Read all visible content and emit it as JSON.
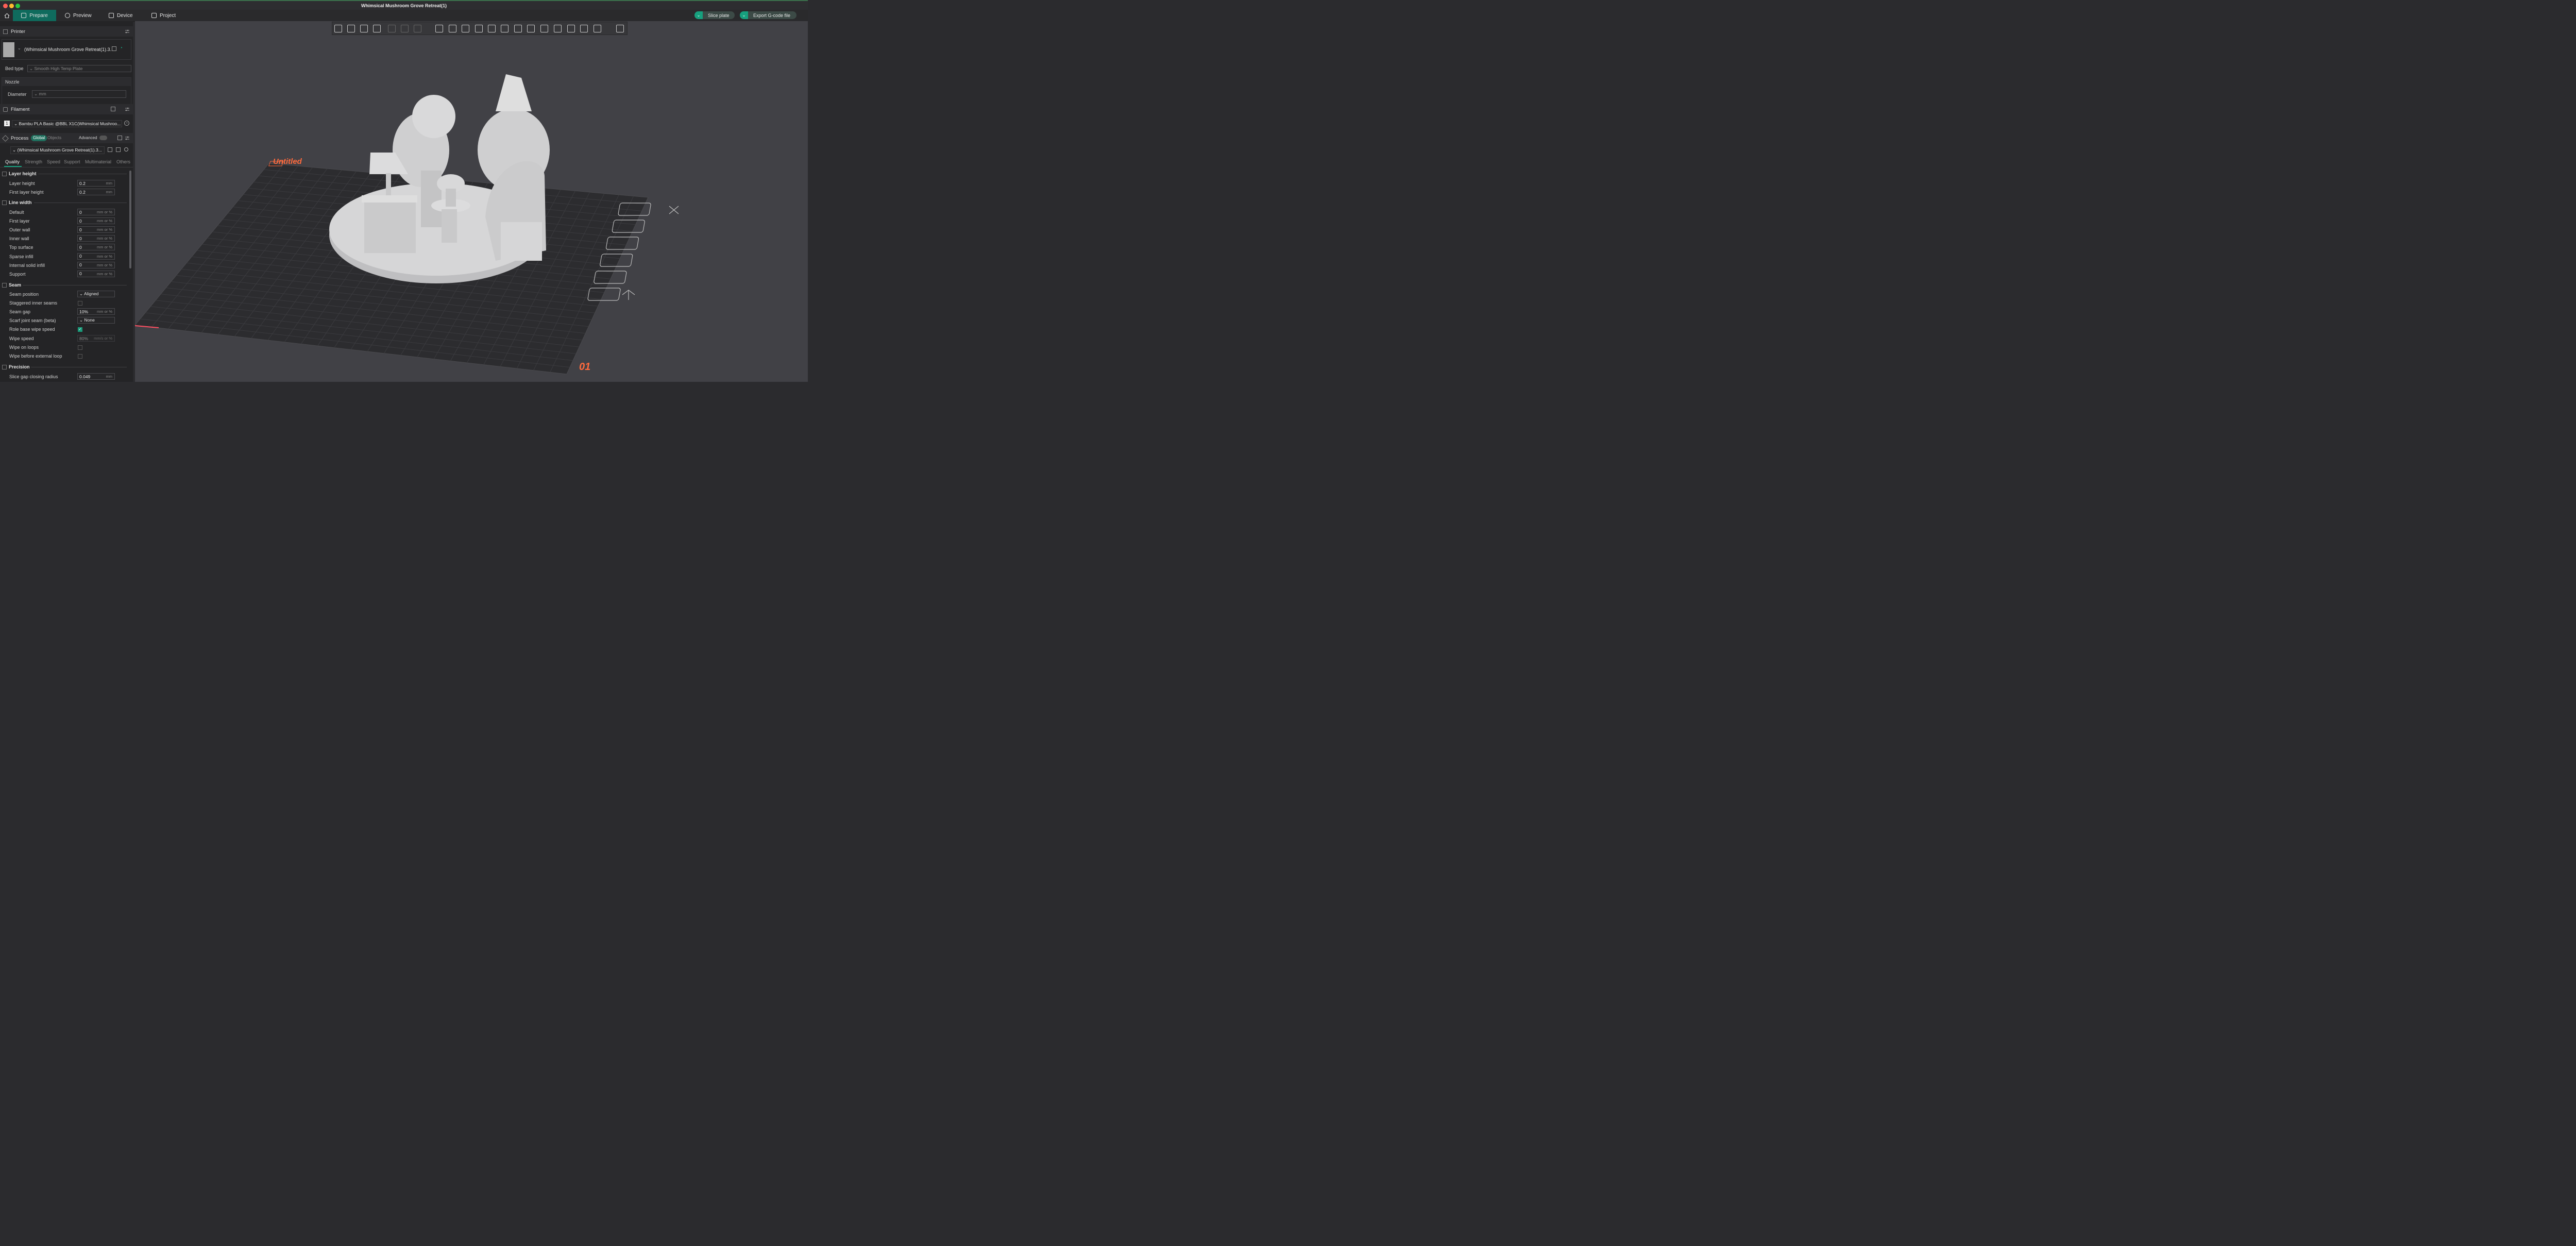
{
  "window": {
    "title": "Whimsical Mushroom Grove Retreat(1)"
  },
  "colors": {
    "accent": "#17a07e",
    "active_tab": "#0f6b5d",
    "plate_label": "#ff6a3d"
  },
  "menubar": {
    "tabs": [
      {
        "label": "Prepare",
        "icon": "cube-icon"
      },
      {
        "label": "Preview",
        "icon": "layers-icon"
      },
      {
        "label": "Device",
        "icon": "device-icon"
      },
      {
        "label": "Project",
        "icon": "project-icon"
      }
    ],
    "slice_label": "Slice plate",
    "export_label": "Export G-code file"
  },
  "printer": {
    "header": "Printer",
    "name": "(Whimsical Mushroom Grove Retreat(1).3...",
    "bed_type_label": "Bed type",
    "bed_type_value": "Smooth High Temp Plate",
    "nozzle_label": "Nozzle",
    "diameter_label": "Diameter",
    "diameter_unit": "mm"
  },
  "filament": {
    "header": "Filament",
    "slot": "1",
    "name": "Bambu PLA Basic @BBL X1C(Whimsical Mushroo..."
  },
  "process": {
    "header": "Process",
    "global_label": "Global",
    "objects_label": "Objects",
    "advanced_label": "Advanced",
    "preset": "(Whimsical Mushroom Grove Retreat(1).3...",
    "tabs": [
      "Quality",
      "Strength",
      "Speed",
      "Support",
      "Multimaterial",
      "Others"
    ]
  },
  "quality": {
    "layer_height_group": "Layer height",
    "layer_height_label": "Layer height",
    "layer_height": "0.2",
    "first_layer_height_label": "First layer height",
    "first_layer_height": "0.2",
    "unit_mm": "mm",
    "unit_mm_pct": "mm or %",
    "line_width_group": "Line width",
    "line_widths": [
      {
        "label": "Default",
        "value": "0"
      },
      {
        "label": "First layer",
        "value": "0"
      },
      {
        "label": "Outer wall",
        "value": "0"
      },
      {
        "label": "Inner wall",
        "value": "0"
      },
      {
        "label": "Top surface",
        "value": "0"
      },
      {
        "label": "Sparse infill",
        "value": "0"
      },
      {
        "label": "Internal solid infill",
        "value": "0"
      },
      {
        "label": "Support",
        "value": "0"
      }
    ],
    "seam_group": "Seam",
    "seam_position_label": "Seam position",
    "seam_position": "Aligned",
    "staggered_label": "Staggered inner seams",
    "seam_gap_label": "Seam gap",
    "seam_gap": "10%",
    "scarf_label": "Scarf joint seam (beta)",
    "scarf": "None",
    "role_wipe_label": "Role base wipe speed",
    "wipe_speed_label": "Wipe speed",
    "wipe_speed": "80%",
    "wipe_speed_unit": "mm/s or %",
    "wipe_loops_label": "Wipe on loops",
    "wipe_before_label": "Wipe before external loop",
    "precision_group": "Precision",
    "slice_gap_label": "Slice gap closing radius",
    "slice_gap": "0.049"
  },
  "viewport": {
    "plate_name": "Untitled",
    "plate_number": "01"
  }
}
